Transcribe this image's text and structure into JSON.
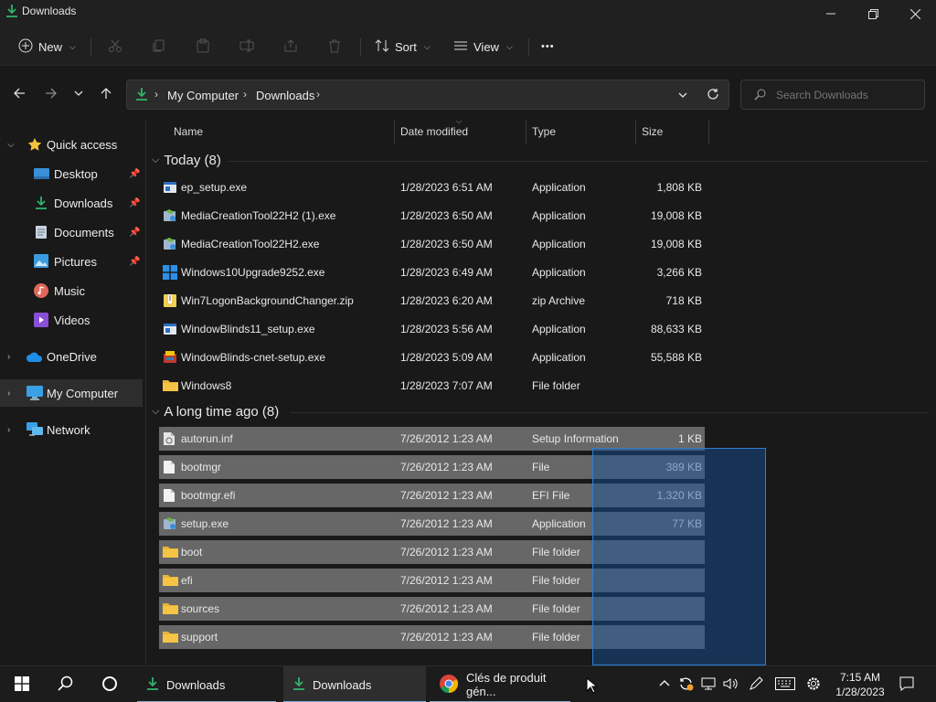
{
  "window": {
    "title": "Downloads",
    "minimize": "–",
    "maximize": "❐",
    "close": "✕"
  },
  "toolbar": {
    "new_label": "New",
    "sort_label": "Sort",
    "view_label": "View",
    "more_label": "•••"
  },
  "address": {
    "crumbs": [
      "My Computer",
      "Downloads"
    ],
    "search_placeholder": "Search Downloads"
  },
  "sidebar": {
    "items": [
      {
        "label": "Quick access",
        "icon": "star-icon"
      },
      {
        "label": "Desktop",
        "icon": "desktop-icon",
        "pinned": true
      },
      {
        "label": "Downloads",
        "icon": "download-icon",
        "pinned": true
      },
      {
        "label": "Documents",
        "icon": "documents-icon",
        "pinned": true
      },
      {
        "label": "Pictures",
        "icon": "pictures-icon",
        "pinned": true
      },
      {
        "label": "Music",
        "icon": "music-icon"
      },
      {
        "label": "Videos",
        "icon": "videos-icon"
      },
      {
        "label": "OneDrive",
        "icon": "cloud-icon"
      },
      {
        "label": "My Computer",
        "icon": "computer-icon",
        "selected": true
      },
      {
        "label": "Network",
        "icon": "network-icon"
      }
    ]
  },
  "columns": {
    "name": "Name",
    "date": "Date modified",
    "type": "Type",
    "size": "Size"
  },
  "groups": [
    {
      "label": "Today (8)",
      "rows": [
        {
          "name": "ep_setup.exe",
          "date": "1/28/2023 6:51 AM",
          "type": "Application",
          "size": "1,808 KB",
          "icon": "exe-icon"
        },
        {
          "name": "MediaCreationTool22H2 (1).exe",
          "date": "1/28/2023 6:50 AM",
          "type": "Application",
          "size": "19,008 KB",
          "icon": "setup-icon"
        },
        {
          "name": "MediaCreationTool22H2.exe",
          "date": "1/28/2023 6:50 AM",
          "type": "Application",
          "size": "19,008 KB",
          "icon": "setup-icon"
        },
        {
          "name": "Windows10Upgrade9252.exe",
          "date": "1/28/2023 6:49 AM",
          "type": "Application",
          "size": "3,266 KB",
          "icon": "windows-icon"
        },
        {
          "name": "Win7LogonBackgroundChanger.zip",
          "date": "1/28/2023 6:20 AM",
          "type": "zip Archive",
          "size": "718 KB",
          "icon": "zip-icon"
        },
        {
          "name": "WindowBlinds11_setup.exe",
          "date": "1/28/2023 5:56 AM",
          "type": "Application",
          "size": "88,633 KB",
          "icon": "exe-icon"
        },
        {
          "name": "WindowBlinds-cnet-setup.exe",
          "date": "1/28/2023 5:09 AM",
          "type": "Application",
          "size": "55,588 KB",
          "icon": "installer-icon"
        },
        {
          "name": "Windows8",
          "date": "1/28/2023 7:07 AM",
          "type": "File folder",
          "size": "",
          "icon": "folder-icon"
        }
      ]
    },
    {
      "label": "A long time ago (8)",
      "rows": [
        {
          "name": "autorun.inf",
          "date": "7/26/2012 1:23 AM",
          "type": "Setup Information",
          "size": "1 KB",
          "icon": "inf-icon"
        },
        {
          "name": "bootmgr",
          "date": "7/26/2012 1:23 AM",
          "type": "File",
          "size": "389 KB",
          "icon": "file-icon"
        },
        {
          "name": "bootmgr.efi",
          "date": "7/26/2012 1:23 AM",
          "type": "EFI File",
          "size": "1,320 KB",
          "icon": "file-icon"
        },
        {
          "name": "setup.exe",
          "date": "7/26/2012 1:23 AM",
          "type": "Application",
          "size": "77 KB",
          "icon": "setup-icon"
        },
        {
          "name": "boot",
          "date": "7/26/2012 1:23 AM",
          "type": "File folder",
          "size": "",
          "icon": "folder-icon"
        },
        {
          "name": "efi",
          "date": "7/26/2012 1:23 AM",
          "type": "File folder",
          "size": "",
          "icon": "folder-icon"
        },
        {
          "name": "sources",
          "date": "7/26/2012 1:23 AM",
          "type": "File folder",
          "size": "",
          "icon": "folder-icon"
        },
        {
          "name": "support",
          "date": "7/26/2012 1:23 AM",
          "type": "File folder",
          "size": "",
          "icon": "folder-icon"
        }
      ]
    }
  ],
  "taskbar": {
    "apps": [
      {
        "label": "Downloads",
        "icon": "download-icon"
      },
      {
        "label": "Downloads",
        "icon": "download-icon",
        "active": true
      },
      {
        "label": "Clés de produit gén...",
        "icon": "chrome-icon"
      }
    ],
    "time": "7:15 AM",
    "date": "1/28/2023"
  },
  "colors": {
    "accent": "#0078d4",
    "selection": "#676767",
    "folder": "#f6c445",
    "download_green": "#2fb36a"
  }
}
